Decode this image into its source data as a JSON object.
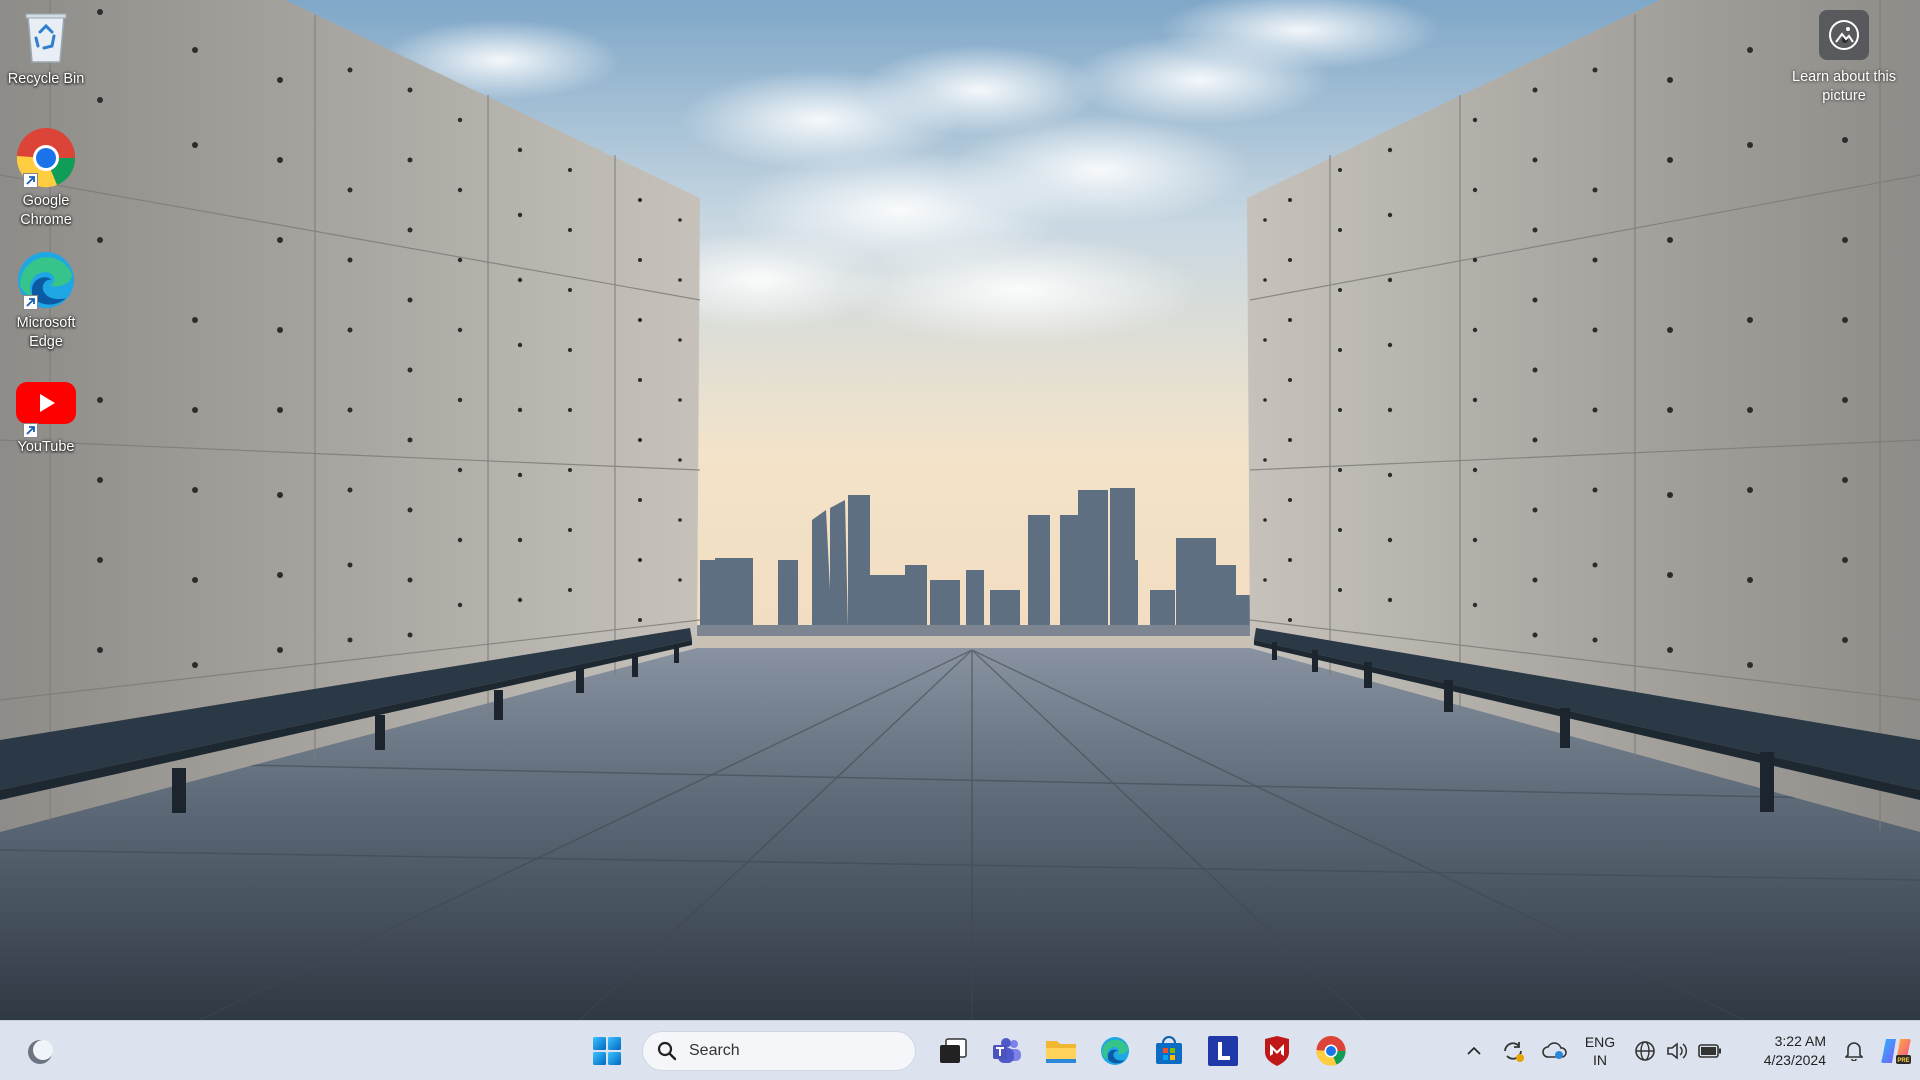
{
  "desktop": {
    "icons": [
      {
        "label": "Recycle Bin",
        "icon": "recycle-bin-icon"
      },
      {
        "label": "Google Chrome",
        "icon": "chrome-icon"
      },
      {
        "label": "Microsoft Edge",
        "icon": "edge-icon"
      },
      {
        "label": "YouTube",
        "icon": "youtube-icon"
      }
    ],
    "spotlight_label": "Learn about this picture"
  },
  "taskbar": {
    "search_placeholder": "Search",
    "apps": [
      "start-icon",
      "search-icon",
      "task-view-icon",
      "teams-icon",
      "file-explorer-icon",
      "edge-icon",
      "microsoft-store-icon",
      "l-app-icon",
      "mcafee-icon",
      "chrome-icon"
    ],
    "tray": {
      "lang_line1": "ENG",
      "lang_line2": "IN",
      "time": "3:22 AM",
      "date": "4/23/2024"
    }
  },
  "colors": {
    "taskbar_bg": "#dde3ee",
    "sky_top": "#8fb3cf",
    "concrete": "#9c9a96",
    "floor": "#4d5866"
  }
}
